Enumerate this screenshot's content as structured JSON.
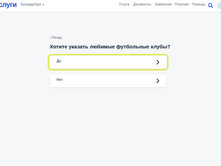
{
  "header": {
    "logo_main": "слуги",
    "location": "Брандербург",
    "nav": [
      "Услуги",
      "Документы",
      "Заявления",
      "Платежи",
      "Помощь"
    ]
  },
  "back_label": "‹ Назад",
  "question": "Хотите указать любимые футбольные клубы?",
  "options": [
    {
      "label": "Да",
      "selected": true
    },
    {
      "label": "Нет",
      "selected": false
    }
  ],
  "colors": {
    "brand_blue": "#0d4cd3",
    "brand_red": "#ee3f58",
    "highlight": "#dfe85a"
  },
  "icons": [
    "search-icon",
    "profile-icon",
    "chevron-right-icon"
  ]
}
